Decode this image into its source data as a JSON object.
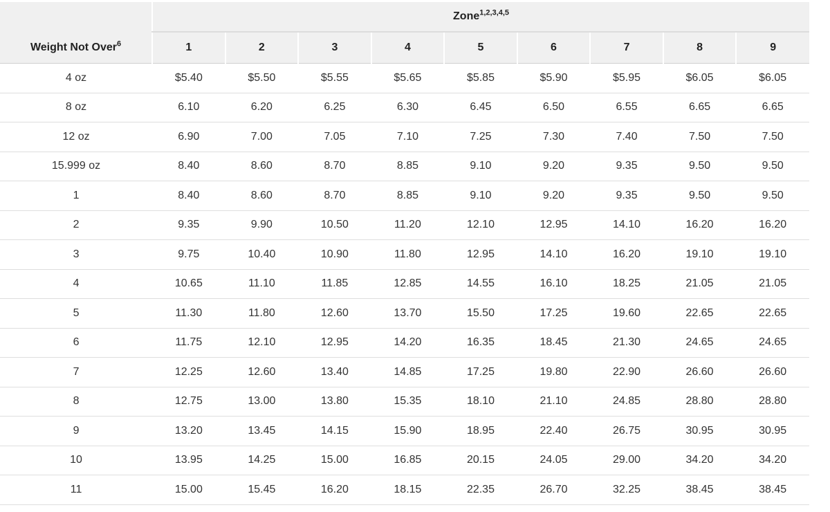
{
  "table": {
    "weight_header": "Weight Not Over",
    "weight_header_sup": "6",
    "zone_header": "Zone",
    "zone_header_sup": "1,2,3,4,5",
    "zones": [
      "1",
      "2",
      "3",
      "4",
      "5",
      "6",
      "7",
      "8",
      "9"
    ],
    "rows": [
      {
        "weight": "4 oz",
        "rates": [
          "$5.40",
          "$5.50",
          "$5.55",
          "$5.65",
          "$5.85",
          "$5.90",
          "$5.95",
          "$6.05",
          "$6.05"
        ]
      },
      {
        "weight": "8 oz",
        "rates": [
          "6.10",
          "6.20",
          "6.25",
          "6.30",
          "6.45",
          "6.50",
          "6.55",
          "6.65",
          "6.65"
        ]
      },
      {
        "weight": "12 oz",
        "rates": [
          "6.90",
          "7.00",
          "7.05",
          "7.10",
          "7.25",
          "7.30",
          "7.40",
          "7.50",
          "7.50"
        ]
      },
      {
        "weight": "15.999 oz",
        "rates": [
          "8.40",
          "8.60",
          "8.70",
          "8.85",
          "9.10",
          "9.20",
          "9.35",
          "9.50",
          "9.50"
        ]
      },
      {
        "weight": "1",
        "rates": [
          "8.40",
          "8.60",
          "8.70",
          "8.85",
          "9.10",
          "9.20",
          "9.35",
          "9.50",
          "9.50"
        ]
      },
      {
        "weight": "2",
        "rates": [
          "9.35",
          "9.90",
          "10.50",
          "11.20",
          "12.10",
          "12.95",
          "14.10",
          "16.20",
          "16.20"
        ]
      },
      {
        "weight": "3",
        "rates": [
          "9.75",
          "10.40",
          "10.90",
          "11.80",
          "12.95",
          "14.10",
          "16.20",
          "19.10",
          "19.10"
        ]
      },
      {
        "weight": "4",
        "rates": [
          "10.65",
          "11.10",
          "11.85",
          "12.85",
          "14.55",
          "16.10",
          "18.25",
          "21.05",
          "21.05"
        ]
      },
      {
        "weight": "5",
        "rates": [
          "11.30",
          "11.80",
          "12.60",
          "13.70",
          "15.50",
          "17.25",
          "19.60",
          "22.65",
          "22.65"
        ]
      },
      {
        "weight": "6",
        "rates": [
          "11.75",
          "12.10",
          "12.95",
          "14.20",
          "16.35",
          "18.45",
          "21.30",
          "24.65",
          "24.65"
        ]
      },
      {
        "weight": "7",
        "rates": [
          "12.25",
          "12.60",
          "13.40",
          "14.85",
          "17.25",
          "19.80",
          "22.90",
          "26.60",
          "26.60"
        ]
      },
      {
        "weight": "8",
        "rates": [
          "12.75",
          "13.00",
          "13.80",
          "15.35",
          "18.10",
          "21.10",
          "24.85",
          "28.80",
          "28.80"
        ]
      },
      {
        "weight": "9",
        "rates": [
          "13.20",
          "13.45",
          "14.15",
          "15.90",
          "18.95",
          "22.40",
          "26.75",
          "30.95",
          "30.95"
        ]
      },
      {
        "weight": "10",
        "rates": [
          "13.95",
          "14.25",
          "15.00",
          "16.85",
          "20.15",
          "24.05",
          "29.00",
          "34.20",
          "34.20"
        ]
      },
      {
        "weight": "11",
        "rates": [
          "15.00",
          "15.45",
          "16.20",
          "18.15",
          "22.35",
          "26.70",
          "32.25",
          "38.45",
          "38.45"
        ]
      }
    ]
  }
}
